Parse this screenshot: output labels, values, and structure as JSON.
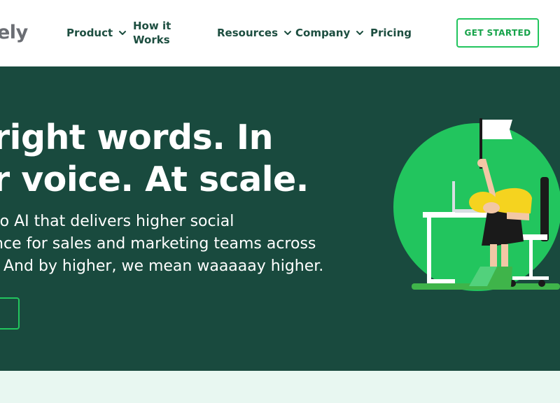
{
  "header": {
    "logo_text": "ely",
    "nav": {
      "product": "Product",
      "how_it_works": "How it Works",
      "resources": "Resources",
      "company": "Company",
      "pricing": "Pricing"
    },
    "cta_label": "GET STARTED"
  },
  "hero": {
    "headline_line1": "right words. In",
    "headline_line2": "r voice. At scale.",
    "sub_line1": "to AI that delivers higher social",
    "sub_line2": "nce for sales and marketing teams across",
    "sub_line3": ". And by higher, we mean waaaaay higher."
  },
  "colors": {
    "brand_dark": "#194a3e",
    "accent_green": "#22c55e",
    "nav_text": "#1d4e40",
    "section_tint": "#e8f7f1"
  },
  "icons": {
    "dropdown": "chevron-down-icon",
    "illustration": "woman-at-desk-waving-flag-illustration"
  }
}
